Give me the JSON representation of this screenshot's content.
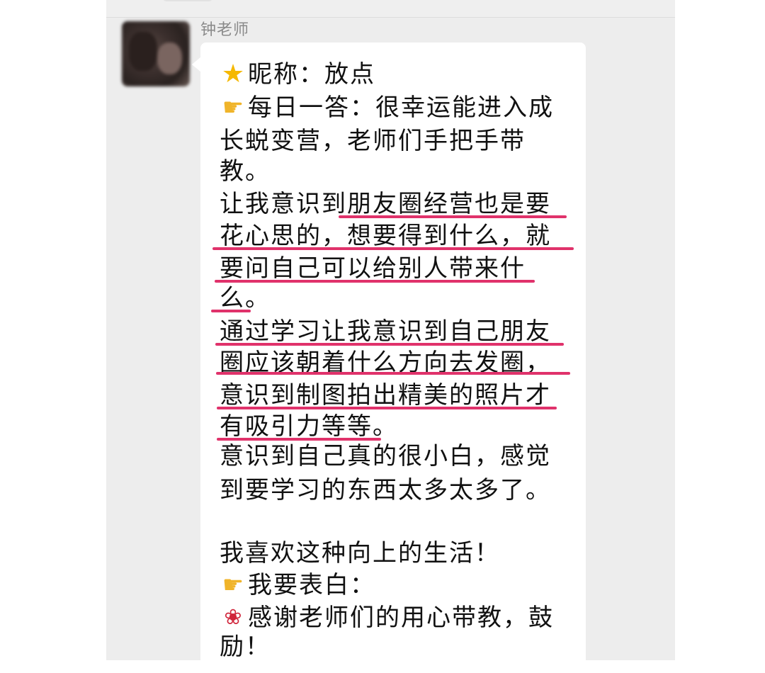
{
  "header": {
    "sender_name": "钟老师"
  },
  "icons": {
    "star": "star-emoji",
    "hand": "pointing-hand-emoji",
    "rose": "rose-emoji"
  },
  "message": {
    "lines": [
      "昵称：放点",
      "每日一答：很幸运能进入成",
      "长蜕变营，老师们手把手带",
      "教。",
      "让我意识到朋友圈经营也是要",
      "花心思的，想要得到什么，就",
      "要问自己可以给别人带来什",
      "么。",
      "通过学习让我意识到自己朋友",
      "圈应该朝着什么方向去发圈，",
      "意识到制图拍出精美的照片才",
      "有吸引力等等。",
      "意识到自己真的很小白，感觉",
      "到要学习的东西太多太多了。",
      "",
      "我喜欢这种向上的生活！",
      "我要表白：",
      "感谢老师们的用心带教，鼓",
      "励！"
    ]
  },
  "colors": {
    "underline": "#e0326b",
    "bubble": "#ffffff",
    "panel": "#ededed"
  }
}
